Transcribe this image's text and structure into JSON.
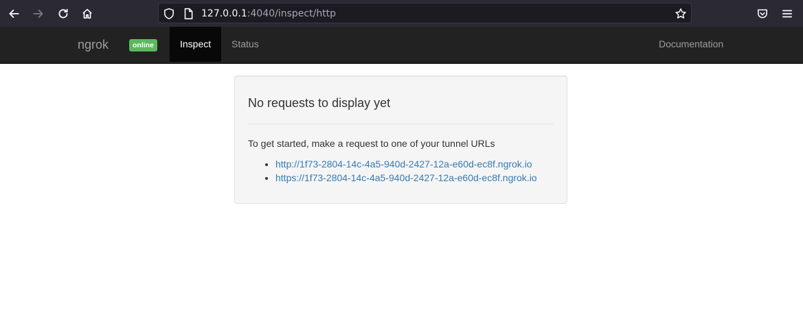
{
  "browser": {
    "url_host": "127.0.0.1",
    "url_rest": ":4040/inspect/http"
  },
  "navbar": {
    "brand": "ngrok",
    "status_badge": "online",
    "tabs": [
      {
        "label": "Inspect",
        "active": true
      },
      {
        "label": "Status",
        "active": false
      }
    ],
    "documentation": "Documentation"
  },
  "panel": {
    "title": "No requests to display yet",
    "lead": "To get started, make a request to one of your tunnel URLs",
    "urls": [
      "http://1f73-2804-14c-4a5-940d-2427-12a-e60d-ec8f.ngrok.io",
      "https://1f73-2804-14c-4a5-940d-2427-12a-e60d-ec8f.ngrok.io"
    ]
  }
}
